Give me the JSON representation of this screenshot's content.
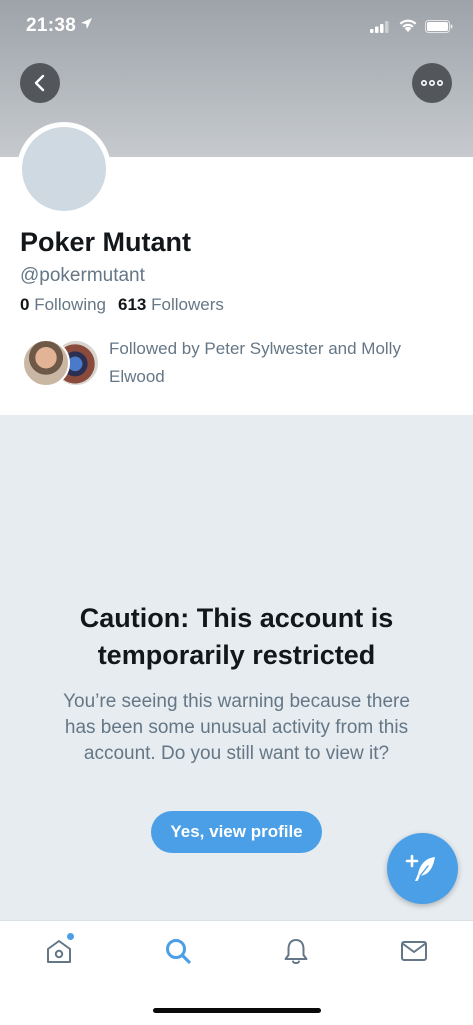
{
  "status_bar": {
    "time": "21:38"
  },
  "profile": {
    "name": "Poker Mutant",
    "handle": "@pokermutant",
    "following_count": "0",
    "following_label": "Following",
    "followers_count": "613",
    "followers_label": "Followers",
    "followed_by": "Followed by Peter Sylwester and Molly Elwood"
  },
  "caution": {
    "title": "Caution: This account is temporarily restricted",
    "body": "You’re seeing this warning because there has been some unusual activity from this account. Do you still want to view it?",
    "button_label": "Yes, view profile"
  },
  "icons": {
    "back": "chevron-left-icon",
    "more": "more-horizontal-icon",
    "compose": "compose-tweet-icon",
    "home": "home-icon",
    "search": "search-icon",
    "notifications": "bell-icon",
    "messages": "envelope-icon"
  },
  "colors": {
    "accent": "#4a9fe6",
    "banner": "#b4b8bd",
    "muted_text": "#657786",
    "restricted_bg": "#e6ecf0"
  }
}
